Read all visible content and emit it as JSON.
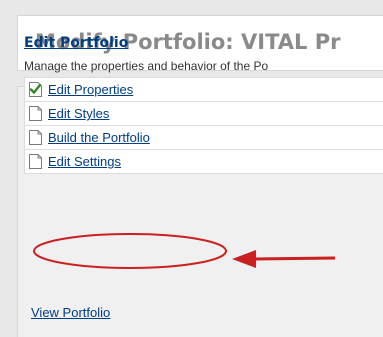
{
  "header": {
    "title": "Modify Portfolio: VITAL Pr"
  },
  "section": {
    "title": "Edit Portfolio",
    "description": "Manage the properties and behavior of the Po"
  },
  "items": [
    {
      "label": "Edit Properties",
      "icon": "checked-page-icon"
    },
    {
      "label": "Edit Styles",
      "icon": "page-icon"
    },
    {
      "label": "Build the Portfolio",
      "icon": "page-icon"
    },
    {
      "label": "Edit Settings",
      "icon": "page-icon"
    }
  ],
  "footer": {
    "view_link": "View Portfolio"
  },
  "colors": {
    "link": "#003d82",
    "annotation": "#cc1f1f",
    "check": "#2e8b1f"
  }
}
